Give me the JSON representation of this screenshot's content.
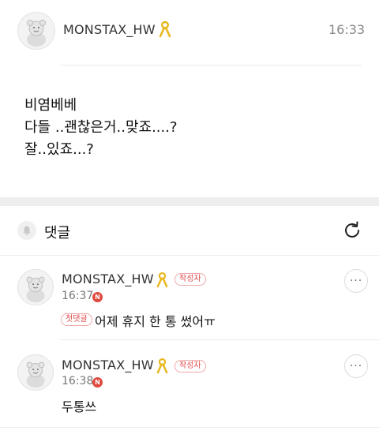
{
  "post": {
    "author": "MONSTAX_HW",
    "time": "16:33",
    "body": [
      "비염베베",
      "다들 ..괜찮은거..맞죠....?",
      "잘..있죠...?"
    ]
  },
  "comments_header": {
    "label": "댓글",
    "refresh_icon": "refresh-icon",
    "bell_icon": "bell-icon"
  },
  "comments": [
    {
      "author": "MONSTAX_HW",
      "author_badge": "작성자",
      "time": "16:37",
      "new_badge": "N",
      "first_badge": "첫댓글",
      "text": "어제 휴지 한 통 썼어ㅠ",
      "more": "···"
    },
    {
      "author": "MONSTAX_HW",
      "author_badge": "작성자",
      "time": "16:38",
      "new_badge": "N",
      "text": "두통쓰",
      "more": "···"
    }
  ],
  "colors": {
    "accent_red": "#e0493f",
    "ribbon": "#e8b820"
  }
}
